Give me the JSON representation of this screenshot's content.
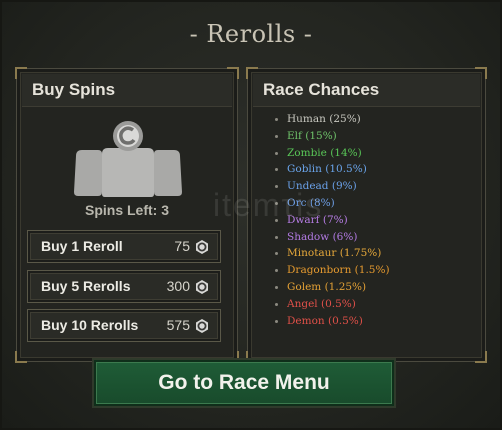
{
  "title": "- Rerolls -",
  "buy_spins": {
    "heading": "Buy Spins",
    "spins_left": "Spins Left: 3",
    "options": [
      {
        "label": "Buy 1 Reroll",
        "price": "75"
      },
      {
        "label": "Buy 5 Rerolls",
        "price": "300"
      },
      {
        "label": "Buy 10 Rerolls",
        "price": "575"
      }
    ],
    "coin_icon": "coin-icon",
    "spin_icon": "reroll-token-icon"
  },
  "race_chances": {
    "heading": "Race Chances",
    "races": [
      {
        "text": "Human (25%)",
        "color": "#c8c8c0"
      },
      {
        "text": "Elf (15%)",
        "color": "#6fc36a"
      },
      {
        "text": "Zombie (14%)",
        "color": "#59c657"
      },
      {
        "text": "Goblin (10.5%)",
        "color": "#6aa4ea"
      },
      {
        "text": "Undead (9%)",
        "color": "#6aa0e8"
      },
      {
        "text": "Orc (8%)",
        "color": "#6e9fe6"
      },
      {
        "text": "Dwarf (7%)",
        "color": "#b77de6"
      },
      {
        "text": "Shadow (6%)",
        "color": "#b27ae3"
      },
      {
        "text": "Minotaur (1.75%)",
        "color": "#e6a83a"
      },
      {
        "text": "Dragonborn (1.5%)",
        "color": "#e59a2f"
      },
      {
        "text": "Golem (1.25%)",
        "color": "#e2a035"
      },
      {
        "text": "Angel (0.5%)",
        "color": "#e0504a"
      },
      {
        "text": "Demon (0.5%)",
        "color": "#e05048"
      }
    ]
  },
  "go_button": "Go to Race Menu",
  "watermark": "itemτis"
}
